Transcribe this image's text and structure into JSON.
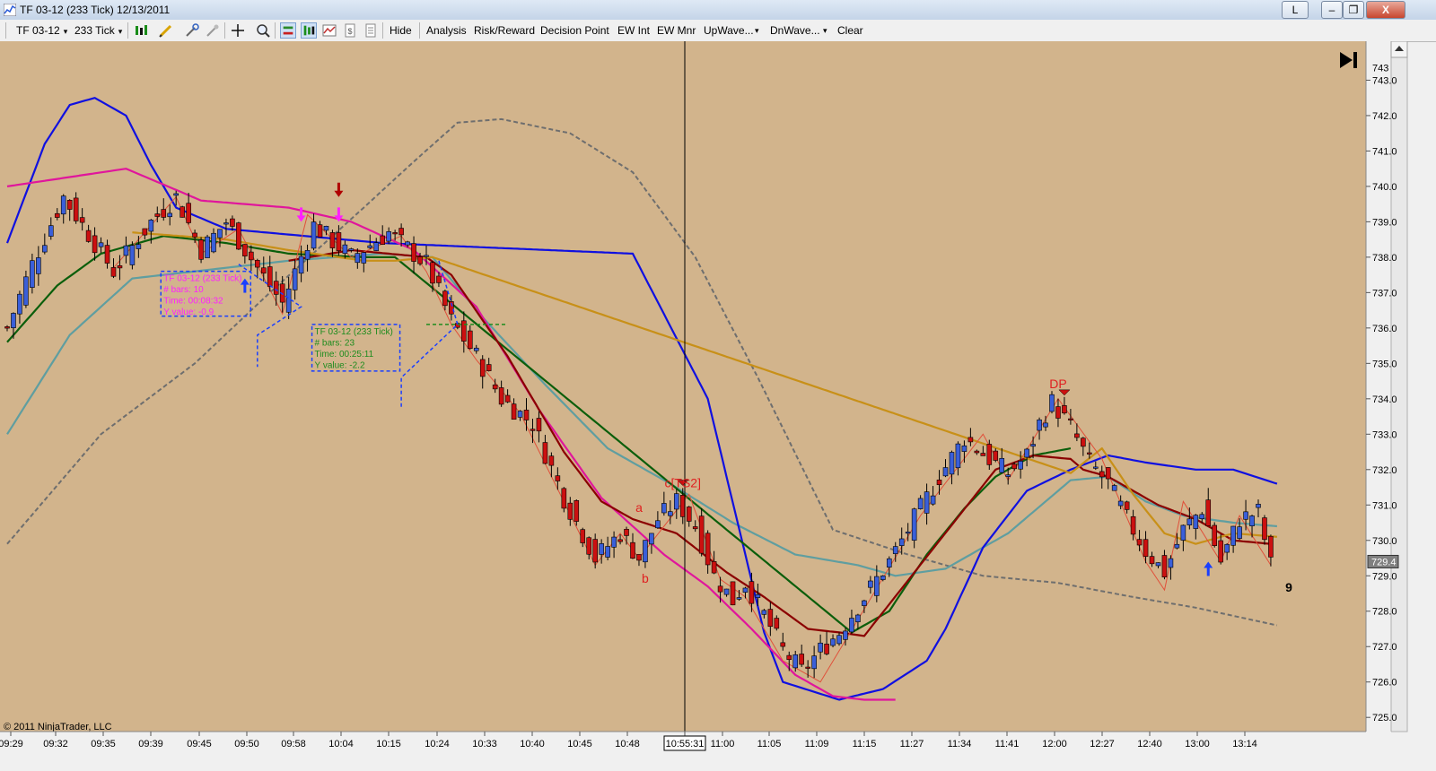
{
  "window": {
    "title": "TF 03-12 (233 Tick)  12/13/2011",
    "buttons": {
      "layout": "L",
      "minimize": "–",
      "maximize": "❐",
      "close": "X"
    }
  },
  "toolbar": {
    "instrument": "TF 03-12",
    "interval": "233 Tick",
    "items": [
      "Hide",
      "Analysis",
      "Risk/Reward",
      "Decision Point",
      "EW Int",
      "EW Mnr",
      "UpWave...",
      "DnWave...",
      "Clear"
    ],
    "icons": [
      "bar-type-icon",
      "drawing-pencil-icon",
      "properties-icon",
      "crosshair-icon",
      "zoom-icon",
      "chart-trader-icon",
      "strategy-icon",
      "indicators-icon",
      "data-box-icon",
      "copy-icon"
    ]
  },
  "chart_data": {
    "type": "candlestick",
    "instrument": "TF 03-12 (233 Tick)",
    "date": "12/13/2011",
    "ylim": [
      724.6,
      744.1
    ],
    "y_ticks": [
      "743.0",
      "742.0",
      "741.0",
      "740.0",
      "739.0",
      "738.0",
      "737.0",
      "736.0",
      "735.0",
      "734.0",
      "733.0",
      "732.0",
      "731.0",
      "730.0",
      "729.0",
      "728.0",
      "727.0",
      "726.0",
      "725.0"
    ],
    "x_ticks": [
      "09:29",
      "09:32",
      "09:35",
      "09:39",
      "09:45",
      "09:50",
      "09:58",
      "10:04",
      "10:15",
      "10:24",
      "10:33",
      "10:40",
      "10:45",
      "10:48",
      "10:55:31",
      "11:00",
      "11:05",
      "11:09",
      "11:15",
      "11:27",
      "11:34",
      "11:41",
      "12:00",
      "12:27",
      "12:40",
      "13:00",
      "13:14"
    ],
    "cursor_time": "10:55:31",
    "current_price": "729.4",
    "top_price_label": "743",
    "bar_countdown": "9",
    "copyright": "© 2011 NinjaTrader, LLC",
    "price_path": [
      [
        0,
        736.0
      ],
      [
        4,
        737.8
      ],
      [
        9,
        739.7
      ],
      [
        14,
        738.4
      ],
      [
        17,
        737.6
      ],
      [
        23,
        739.0
      ],
      [
        27,
        739.7
      ],
      [
        31,
        738.2
      ],
      [
        35,
        739.0
      ],
      [
        40,
        737.7
      ],
      [
        44,
        736.7
      ],
      [
        49,
        738.9
      ],
      [
        55,
        738.0
      ],
      [
        61,
        738.7
      ],
      [
        67,
        737.8
      ],
      [
        71,
        736.2
      ],
      [
        75,
        735.2
      ],
      [
        79,
        734.0
      ],
      [
        84,
        733.3
      ],
      [
        89,
        731.2
      ],
      [
        94,
        729.5
      ],
      [
        98,
        730.2
      ],
      [
        101,
        729.5
      ],
      [
        104,
        730.6
      ],
      [
        107,
        731.1
      ],
      [
        110,
        730.4
      ],
      [
        113,
        729.0
      ],
      [
        116,
        728.3
      ],
      [
        118,
        728.8
      ],
      [
        121,
        727.9
      ],
      [
        124,
        726.9
      ],
      [
        127,
        726.3
      ],
      [
        130,
        726.9
      ],
      [
        133,
        727.4
      ],
      [
        137,
        728.4
      ],
      [
        141,
        729.4
      ],
      [
        145,
        730.6
      ],
      [
        149,
        731.8
      ],
      [
        153,
        732.9
      ],
      [
        157,
        732.3
      ],
      [
        160,
        731.9
      ],
      [
        163,
        732.4
      ],
      [
        165,
        733.3
      ],
      [
        167,
        733.9
      ],
      [
        170,
        733.2
      ],
      [
        173,
        732.2
      ],
      [
        176,
        731.6
      ],
      [
        179,
        730.6
      ],
      [
        182,
        729.7
      ],
      [
        185,
        729.1
      ],
      [
        188,
        730.3
      ],
      [
        191,
        730.9
      ],
      [
        194,
        729.4
      ],
      [
        197,
        730.6
      ],
      [
        200,
        730.8
      ],
      [
        202,
        729.3
      ]
    ],
    "studies": {
      "blue_line": [
        [
          0,
          738.4
        ],
        [
          6,
          741.2
        ],
        [
          10,
          742.3
        ],
        [
          14,
          742.5
        ],
        [
          19,
          742.0
        ],
        [
          23,
          740.6
        ],
        [
          27,
          739.4
        ],
        [
          35,
          738.8
        ],
        [
          60,
          738.4
        ],
        [
          100,
          738.1
        ],
        [
          112,
          734.0
        ],
        [
          121,
          727.4
        ],
        [
          124,
          726.0
        ],
        [
          133,
          725.5
        ],
        [
          140,
          725.8
        ],
        [
          147,
          726.6
        ],
        [
          150,
          727.5
        ],
        [
          156,
          729.8
        ],
        [
          163,
          731.4
        ],
        [
          170,
          732.0
        ],
        [
          176,
          732.4
        ],
        [
          182,
          732.2
        ],
        [
          190,
          732.0
        ],
        [
          196,
          732.0
        ],
        [
          203,
          731.6
        ]
      ],
      "magenta_line": [
        [
          0,
          740.0
        ],
        [
          19,
          740.5
        ],
        [
          31,
          739.6
        ],
        [
          45,
          739.4
        ],
        [
          55,
          739.0
        ],
        [
          65,
          738.2
        ],
        [
          75,
          736.6
        ],
        [
          85,
          733.7
        ],
        [
          95,
          731.2
        ],
        [
          105,
          729.6
        ],
        [
          112,
          728.7
        ],
        [
          119,
          727.5
        ],
        [
          126,
          726.2
        ],
        [
          132,
          725.6
        ],
        [
          137,
          725.5
        ],
        [
          142,
          725.5
        ]
      ],
      "darkred_line": [
        [
          45,
          737.9
        ],
        [
          55,
          738.2
        ],
        [
          67,
          738.0
        ],
        [
          71,
          737.5
        ],
        [
          80,
          735.2
        ],
        [
          89,
          732.5
        ],
        [
          95,
          731.1
        ],
        [
          100,
          730.6
        ],
        [
          107,
          730.2
        ],
        [
          115,
          729.1
        ],
        [
          121,
          728.4
        ],
        [
          128,
          727.5
        ],
        [
          133,
          727.4
        ],
        [
          137,
          727.3
        ],
        [
          158,
          732.0
        ],
        [
          164,
          732.4
        ],
        [
          170,
          732.3
        ],
        [
          172,
          732.0
        ],
        [
          176,
          731.8
        ],
        [
          184,
          731.0
        ],
        [
          190,
          730.6
        ],
        [
          196,
          730.0
        ],
        [
          202,
          729.9
        ]
      ],
      "cadet_line": [
        [
          0,
          733.0
        ],
        [
          10,
          735.8
        ],
        [
          20,
          737.4
        ],
        [
          30,
          737.6
        ],
        [
          45,
          737.9
        ],
        [
          60,
          738.1
        ],
        [
          68,
          738.0
        ],
        [
          76,
          736.3
        ],
        [
          86,
          734.4
        ],
        [
          96,
          732.6
        ],
        [
          106,
          731.6
        ],
        [
          116,
          730.5
        ],
        [
          126,
          729.6
        ],
        [
          136,
          729.3
        ],
        [
          142,
          729.0
        ],
        [
          150,
          729.2
        ],
        [
          160,
          730.2
        ],
        [
          170,
          731.7
        ],
        [
          176,
          731.8
        ],
        [
          182,
          731.1
        ],
        [
          188,
          730.7
        ],
        [
          196,
          730.5
        ],
        [
          203,
          730.4
        ]
      ],
      "green_line": [
        [
          0,
          735.6
        ],
        [
          8,
          737.2
        ],
        [
          15,
          738.1
        ],
        [
          25,
          738.6
        ],
        [
          35,
          738.4
        ],
        [
          45,
          738.1
        ],
        [
          57,
          738.0
        ],
        [
          62,
          738.0
        ],
        [
          135,
          727.4
        ],
        [
          141,
          728.0
        ],
        [
          147,
          729.6
        ],
        [
          153,
          730.9
        ],
        [
          158,
          731.8
        ],
        [
          164,
          732.4
        ],
        [
          170,
          732.6
        ]
      ],
      "gold_line": [
        [
          20,
          738.7
        ],
        [
          35,
          738.5
        ],
        [
          45,
          738.2
        ],
        [
          57,
          737.9
        ],
        [
          62,
          737.9
        ],
        [
          68,
          738.0
        ],
        [
          170,
          731.9
        ],
        [
          175,
          732.6
        ],
        [
          180,
          731.3
        ],
        [
          185,
          730.2
        ],
        [
          190,
          729.9
        ],
        [
          196,
          730.2
        ],
        [
          203,
          730.1
        ]
      ],
      "gray_dashed": [
        [
          0,
          729.9
        ],
        [
          15,
          733.0
        ],
        [
          30,
          735.0
        ],
        [
          42,
          737.0
        ],
        [
          57,
          739.4
        ],
        [
          65,
          740.7
        ],
        [
          72,
          741.8
        ],
        [
          79,
          741.9
        ],
        [
          90,
          741.5
        ],
        [
          100,
          740.4
        ],
        [
          110,
          738.0
        ],
        [
          120,
          734.6
        ],
        [
          132,
          730.3
        ],
        [
          144,
          729.6
        ],
        [
          156,
          729.0
        ],
        [
          168,
          728.8
        ],
        [
          180,
          728.4
        ],
        [
          190,
          728.1
        ],
        [
          203,
          727.6
        ]
      ]
    },
    "swing_zigzag": [
      [
        17,
        737.7
      ],
      [
        27,
        739.7
      ],
      [
        31,
        738.1
      ],
      [
        37,
        738.8
      ],
      [
        44,
        736.4
      ],
      [
        48,
        739.2
      ],
      [
        55,
        738.0
      ],
      [
        63,
        738.6
      ],
      [
        67,
        737.6
      ],
      [
        71,
        736.1
      ],
      [
        75,
        735.1
      ],
      [
        82,
        733.6
      ],
      [
        94,
        729.3
      ],
      [
        98,
        730.2
      ],
      [
        101,
        729.5
      ],
      [
        109,
        731.3
      ],
      [
        114,
        728.9
      ],
      [
        118,
        728.4
      ],
      [
        124,
        726.6
      ],
      [
        130,
        726.0
      ],
      [
        146,
        730.7
      ],
      [
        156,
        733.0
      ],
      [
        160,
        731.7
      ],
      [
        168,
        734.0
      ],
      [
        175,
        732.3
      ],
      [
        182,
        729.4
      ],
      [
        185,
        728.6
      ],
      [
        188,
        731.1
      ],
      [
        194,
        729.4
      ],
      [
        197,
        730.7
      ],
      [
        202,
        729.3
      ]
    ],
    "annotations": [
      {
        "text": "c[TS2]",
        "x": 108,
        "y": 731.5,
        "color": "#e02020"
      },
      {
        "text": "a",
        "x": 101,
        "y": 730.8,
        "color": "#e02020"
      },
      {
        "text": "b",
        "x": 102,
        "y": 728.8,
        "color": "#e02020"
      },
      {
        "text": "DP",
        "x": 168,
        "y": 734.3,
        "color": "#e02020"
      }
    ],
    "signal_arrows": [
      {
        "x": 38,
        "y": 737.4,
        "dir": "up",
        "color": "#1a3fff"
      },
      {
        "x": 47,
        "y": 739.0,
        "dir": "down",
        "color": "#ff20ff"
      },
      {
        "x": 53,
        "y": 739.7,
        "dir": "down",
        "color": "#b00000"
      },
      {
        "x": 53,
        "y": 739.0,
        "dir": "down",
        "color": "#ff20ff"
      },
      {
        "x": 192,
        "y": 729.4,
        "dir": "up",
        "color": "#1a3fff"
      }
    ],
    "info_boxes": [
      {
        "color": "#ff20ff",
        "lines": [
          "TF 03-12 (233 Tick)",
          "# bars:   10",
          "Time:     00:08:32",
          "Y value: -0.9"
        ]
      },
      {
        "color": "#1e8c1e",
        "lines": [
          "TF 03-12 (233 Tick)",
          "# bars:   23",
          "Time:     00:25:11",
          "Y value: -2.2"
        ]
      }
    ],
    "colors": {
      "background": "#d2b48c",
      "bull_candle": "#3a5fd9",
      "bear_candle": "#cc1010",
      "blue_line": "#1010e0",
      "magenta_line": "#e0169c",
      "darkred_line": "#8b0000",
      "cadet_line": "#5f9ea0",
      "green_line": "#0b5e0b",
      "gold_line": "#c89018",
      "gray_dashed": "#6e6e6e"
    }
  }
}
